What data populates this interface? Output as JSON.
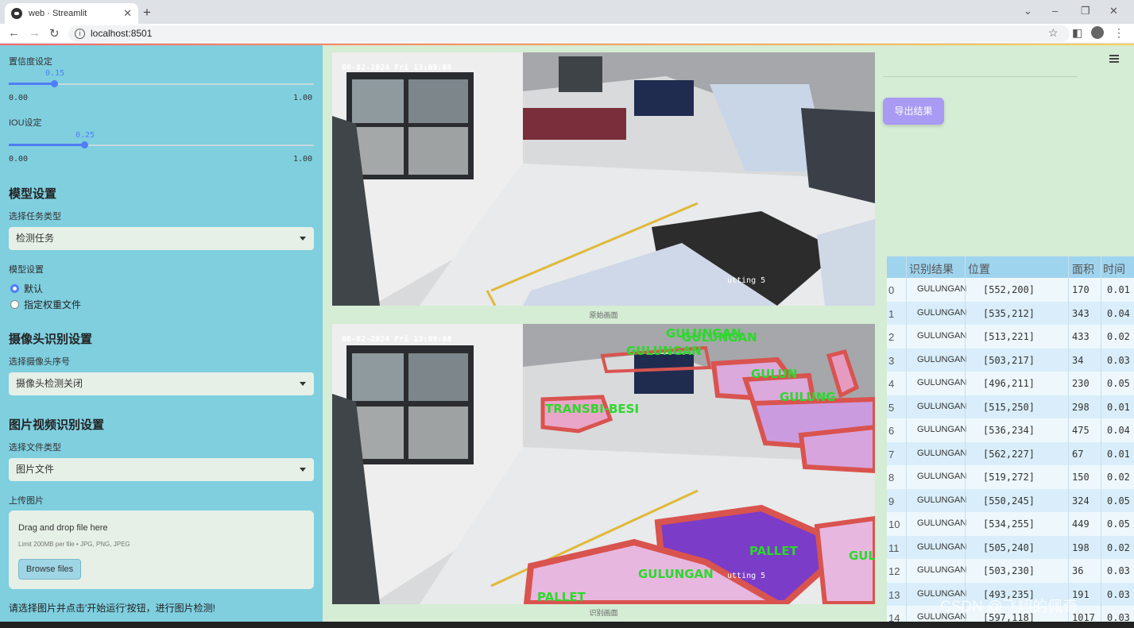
{
  "browser": {
    "tab_title": "web · Streamlit",
    "url": "localhost:8501"
  },
  "sidebar": {
    "conf_label": "置信度设定",
    "conf_value": "0.15",
    "conf_min": "0.00",
    "conf_max": "1.00",
    "conf_fraction": 0.15,
    "iou_label": "IOU设定",
    "iou_value": "0.25",
    "iou_min": "0.00",
    "iou_max": "1.00",
    "iou_fraction": 0.25,
    "model_header": "模型设置",
    "task_label": "选择任务类型",
    "task_value": "检测任务",
    "model_label": "模型设置",
    "radio_default": "默认",
    "radio_custom": "指定权重文件",
    "camera_header": "摄像头识别设置",
    "camera_label": "选择摄像头序号",
    "camera_value": "摄像头检测关闭",
    "media_header": "图片视频识别设置",
    "filetype_label": "选择文件类型",
    "filetype_value": "图片文件",
    "upload_label": "上传图片",
    "upload_title": "Drag and drop file here",
    "upload_sub": "Limit 200MB per file • JPG, PNG, JPEG",
    "browse_label": "Browse files",
    "footer_text": "请选择图片并点击'开始运行'按钮，进行图片检测!"
  },
  "main": {
    "timestamp": "08-02-2024 Fri 13:09:08",
    "cutting_text": "utting 5",
    "original_caption": "原始画面",
    "result_caption": "识别画面",
    "export_label": "导出结果",
    "detection_labels": [
      "GULUNGAN",
      "GULUNGAN",
      "GULUNGAN",
      "GULUN",
      "GULUNG",
      "TRANSBI-BESI",
      "PALLET",
      "GULUNGAN",
      "PALLET",
      "GUL"
    ]
  },
  "table": {
    "headers": [
      "识别结果",
      "位置",
      "面积",
      "时间"
    ],
    "rows": [
      {
        "idx": "0",
        "name": "GULUNGAN",
        "pos": "[552,200]",
        "area": "170",
        "time": "0.01"
      },
      {
        "idx": "1",
        "name": "GULUNGAN",
        "pos": "[535,212]",
        "area": "343",
        "time": "0.04"
      },
      {
        "idx": "2",
        "name": "GULUNGAN",
        "pos": "[513,221]",
        "area": "433",
        "time": "0.02"
      },
      {
        "idx": "3",
        "name": "GULUNGAN",
        "pos": "[503,217]",
        "area": "34",
        "time": "0.03"
      },
      {
        "idx": "4",
        "name": "GULUNGAN",
        "pos": "[496,211]",
        "area": "230",
        "time": "0.05"
      },
      {
        "idx": "5",
        "name": "GULUNGAN",
        "pos": "[515,250]",
        "area": "298",
        "time": "0.01"
      },
      {
        "idx": "6",
        "name": "GULUNGAN",
        "pos": "[536,234]",
        "area": "475",
        "time": "0.04"
      },
      {
        "idx": "7",
        "name": "GULUNGAN",
        "pos": "[562,227]",
        "area": "67",
        "time": "0.01"
      },
      {
        "idx": "8",
        "name": "GULUNGAN",
        "pos": "[519,272]",
        "area": "150",
        "time": "0.02"
      },
      {
        "idx": "9",
        "name": "GULUNGAN",
        "pos": "[550,245]",
        "area": "324",
        "time": "0.05"
      },
      {
        "idx": "10",
        "name": "GULUNGAN",
        "pos": "[534,255]",
        "area": "449",
        "time": "0.05"
      },
      {
        "idx": "11",
        "name": "GULUNGAN",
        "pos": "[505,240]",
        "area": "198",
        "time": "0.02"
      },
      {
        "idx": "12",
        "name": "GULUNGAN",
        "pos": "[503,230]",
        "area": "36",
        "time": "0.03"
      },
      {
        "idx": "13",
        "name": "GULUNGAN",
        "pos": "[493,235]",
        "area": "191",
        "time": "0.03"
      },
      {
        "idx": "14",
        "name": "GULUNGAN",
        "pos": "[597,118]",
        "area": "1017",
        "time": "0.03"
      }
    ]
  },
  "watermark": "CSDN @飞翔的佩奇"
}
